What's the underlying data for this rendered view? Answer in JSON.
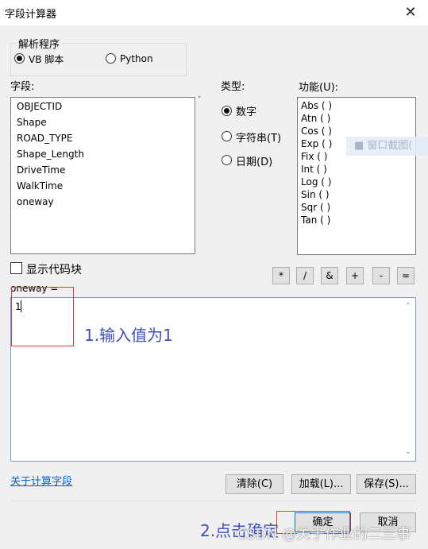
{
  "window": {
    "title": "字段计算器",
    "close_icon": "close-icon"
  },
  "parser": {
    "group_label": "解析程序",
    "options": [
      {
        "label": "VB 脚本",
        "selected": true
      },
      {
        "label": "Python",
        "selected": false
      }
    ]
  },
  "fields": {
    "label": "字段:",
    "items": [
      "OBJECTID",
      "Shape",
      "ROAD_TYPE",
      "Shape_Length",
      "DriveTime",
      "WalkTime",
      "oneway"
    ]
  },
  "type": {
    "label": "类型:",
    "options": [
      {
        "label": "数字",
        "selected": true
      },
      {
        "label": "字符串(T)",
        "selected": false
      },
      {
        "label": "日期(D)",
        "selected": false
      }
    ]
  },
  "functions": {
    "label": "功能(U):",
    "items": [
      "Abs ( )",
      "Atn ( )",
      "Cos ( )",
      "Exp ( )",
      "Fix ( )",
      "Int ( )",
      "Log ( )",
      "Sin ( )",
      "Sqr ( )",
      "Tan ( )"
    ]
  },
  "show_codeblock": {
    "label": "显示代码块",
    "checked": false
  },
  "operators": [
    "*",
    "/",
    "&",
    "+",
    "-",
    "="
  ],
  "expression": {
    "label": "oneway =",
    "value": "1"
  },
  "about_link": "关于计算字段",
  "buttons": {
    "clear": "清除(C)",
    "load": "加载(L)...",
    "save": "保存(S)...",
    "ok": "确定",
    "cancel": "取消"
  },
  "annotations": {
    "step1": "1.输入值为1",
    "step2": "2.点击确定",
    "color": "#3c4fc2",
    "box_color": "#e53935"
  },
  "overlay": {
    "ghost_label": "■  窗口截图(",
    "watermark": "CSDN @关于作业的二三事"
  }
}
